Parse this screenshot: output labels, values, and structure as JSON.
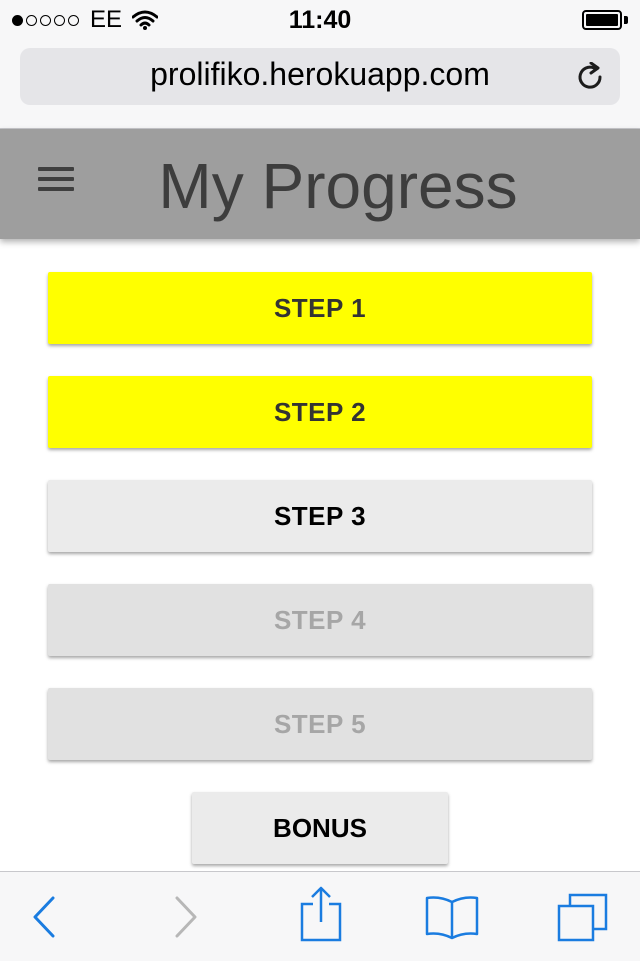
{
  "status_bar": {
    "signal_dots_filled": 1,
    "signal_dots_total": 5,
    "carrier": "EE",
    "time": "11:40",
    "icons": [
      "wifi-icon",
      "battery-icon"
    ]
  },
  "browser": {
    "url": "prolifiko.herokuapp.com",
    "reload_icon": "reload-icon"
  },
  "header": {
    "menu_icon": "hamburger-icon",
    "title": "My Progress",
    "background": "#9e9e9e"
  },
  "steps": [
    {
      "label": "STEP 1",
      "state": "done"
    },
    {
      "label": "STEP 2",
      "state": "done"
    },
    {
      "label": "STEP 3",
      "state": "active"
    },
    {
      "label": "STEP 4",
      "state": "locked"
    },
    {
      "label": "STEP 5",
      "state": "locked"
    }
  ],
  "bonus": {
    "label": "BONUS"
  },
  "colors": {
    "done": "#ffff00",
    "active": "#ebebeb",
    "locked": "#e1e1e1",
    "toolbar_accent": "#1a7ce0"
  },
  "toolbar": {
    "icons": [
      "back-icon",
      "forward-icon",
      "share-icon",
      "bookmarks-icon",
      "tabs-icon"
    ]
  }
}
